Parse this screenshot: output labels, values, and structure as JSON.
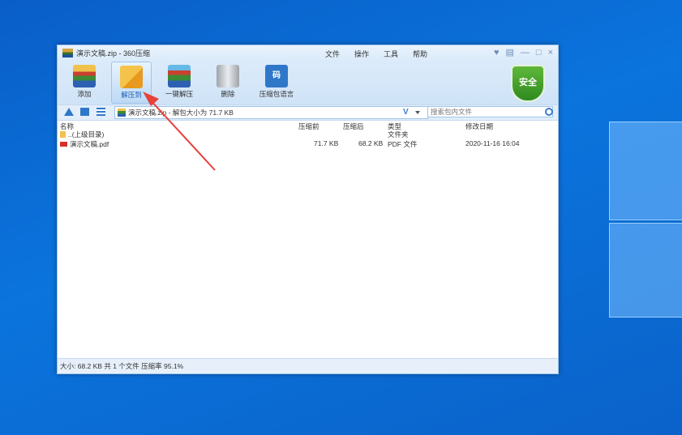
{
  "window": {
    "title": "演示文稿.zip - 360压缩",
    "menus": [
      "文件",
      "操作",
      "工具",
      "帮助"
    ]
  },
  "toolbar": {
    "buttons": [
      {
        "label": "添加",
        "icon": "add-archive-icon"
      },
      {
        "label": "解压到",
        "icon": "extract-to-icon",
        "active": true
      },
      {
        "label": "一键解压",
        "icon": "one-click-extract-icon"
      },
      {
        "label": "删除",
        "icon": "trash-icon"
      },
      {
        "label": "压缩包语言",
        "icon": "archive-language-icon"
      }
    ],
    "shield_label": "安全"
  },
  "address": {
    "path": "演示文稿.zip - 解包大小为 71.7 KB",
    "v_mark": "V",
    "search_placeholder": "搜索包内文件"
  },
  "columns": [
    "名称",
    "压缩前",
    "压缩后",
    "类型",
    "修改日期"
  ],
  "files": [
    {
      "name": "..(上级目录)",
      "before": "",
      "after": "",
      "type": "文件夹",
      "date": "",
      "icon": "folder-icon"
    },
    {
      "name": "演示文稿.pdf",
      "before": "71.7 KB",
      "after": "68.2 KB",
      "type": "PDF 文件",
      "date": "2020-11-16 16:04",
      "icon": "pdf-icon"
    }
  ],
  "status": "大小: 68.2 KB 共 1 个文件 压缩率 95.1%",
  "colors": {
    "accent": "#2f78c9",
    "desktop": "#0b74dd",
    "annotation": "#e8413a"
  }
}
